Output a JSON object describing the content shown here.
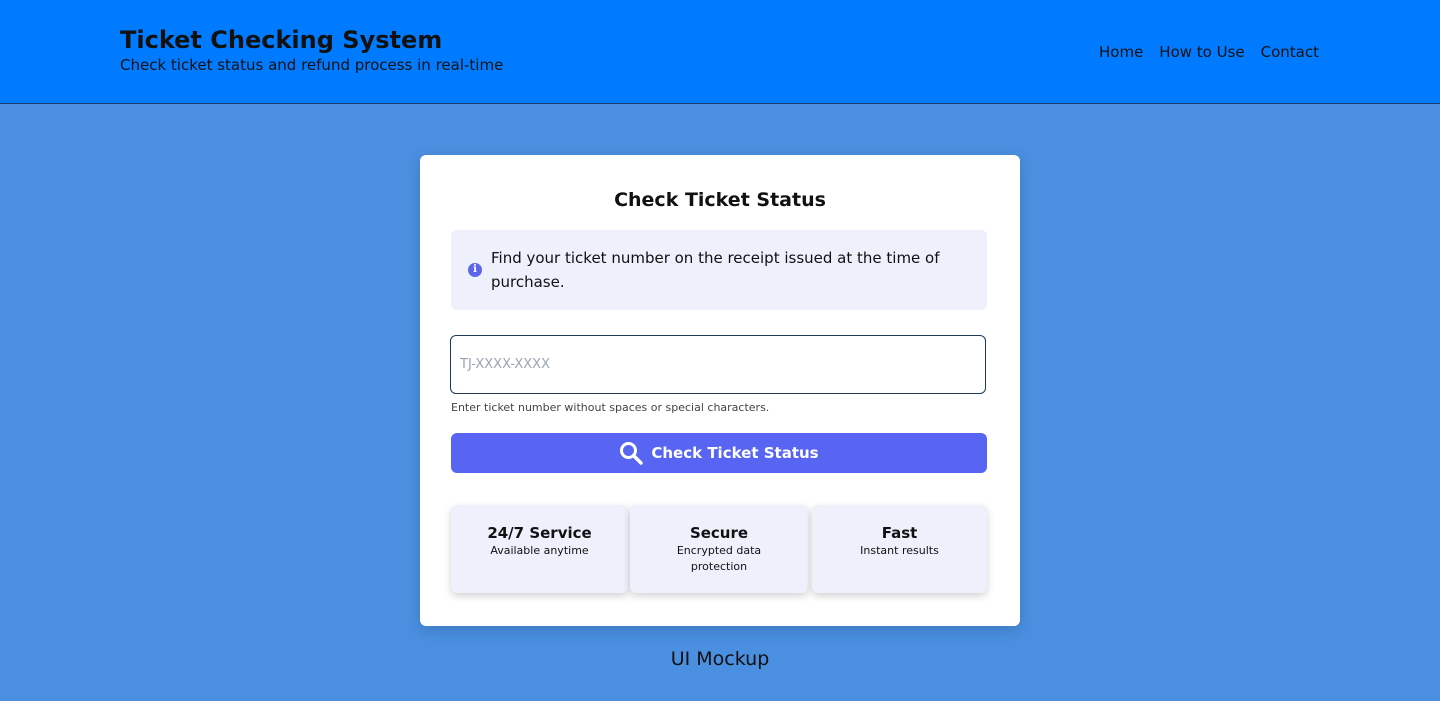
{
  "header": {
    "title": "Ticket Checking System",
    "subtitle": "Check ticket status and refund process in real-time",
    "nav": [
      "Home",
      "How to Use",
      "Contact"
    ]
  },
  "card": {
    "title": "Check Ticket Status",
    "info_text": "Find your ticket number on the receipt issued at the time of purchase.",
    "input": {
      "placeholder": "TJ-XXXX-XXXX",
      "value": ""
    },
    "hint": "Enter ticket number without spaces or special characters.",
    "button_label": "Check Ticket Status",
    "features": [
      {
        "title": "24/7 Service",
        "desc": "Available anytime"
      },
      {
        "title": "Secure",
        "desc": "Encrypted data protection"
      },
      {
        "title": "Fast",
        "desc": "Instant results"
      }
    ]
  },
  "footer_label": "UI Mockup",
  "colors": {
    "header_bg": "#007bff",
    "page_bg": "#4a8fe0",
    "button_bg": "#5765f2",
    "panel_bg": "#eef1fc"
  },
  "icons": {
    "info": "info-circle-icon",
    "button": "search-icon"
  }
}
